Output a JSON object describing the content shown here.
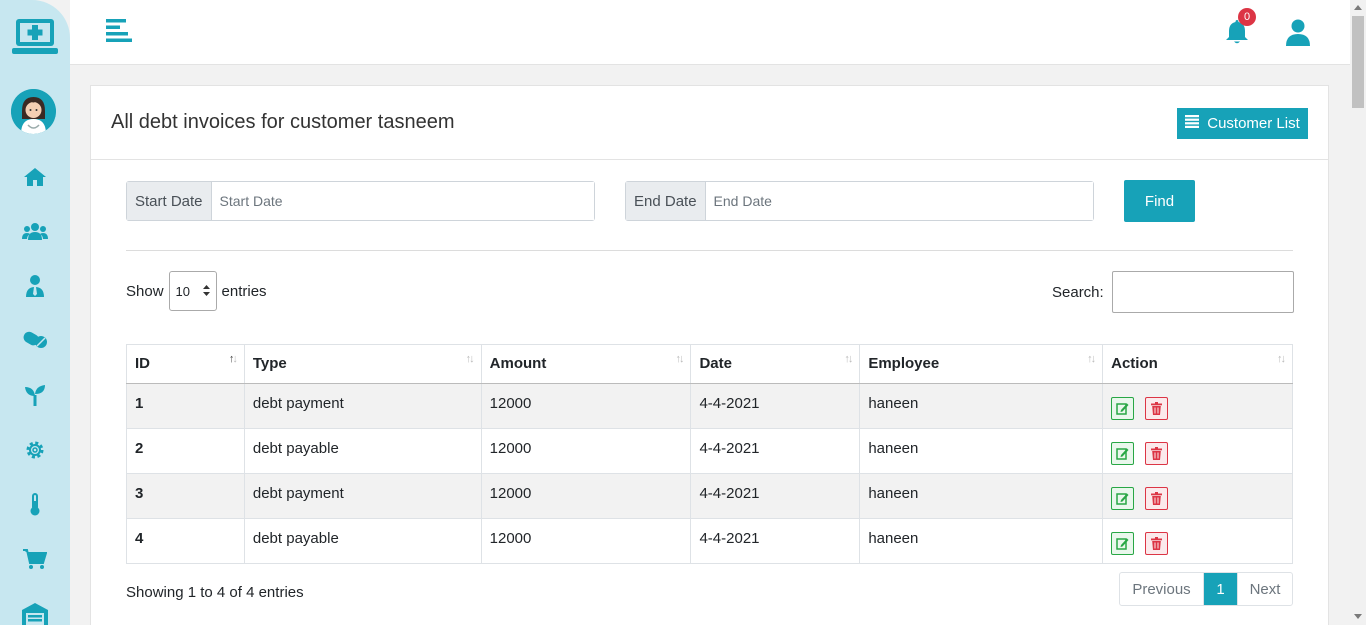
{
  "header": {
    "notification_count": "0"
  },
  "page": {
    "title": "All debt invoices for customer tasneem",
    "customer_list_label": "Customer List"
  },
  "filters": {
    "start_label": "Start Date",
    "start_placeholder": "Start Date",
    "end_label": "End Date",
    "end_placeholder": "End Date",
    "find_label": "Find"
  },
  "table_controls": {
    "show_label": "Show",
    "length_value": "10",
    "entries_label": "entries",
    "search_label": "Search:"
  },
  "table": {
    "columns": [
      "ID",
      "Type",
      "Amount",
      "Date",
      "Employee",
      "Action"
    ],
    "rows": [
      {
        "id": "1",
        "type": "debt payment",
        "amount": "12000",
        "date": "4-4-2021",
        "employee": "haneen"
      },
      {
        "id": "2",
        "type": "debt payable",
        "amount": "12000",
        "date": "4-4-2021",
        "employee": "haneen"
      },
      {
        "id": "3",
        "type": "debt payment",
        "amount": "12000",
        "date": "4-4-2021",
        "employee": "haneen"
      },
      {
        "id": "4",
        "type": "debt payable",
        "amount": "12000",
        "date": "4-4-2021",
        "employee": "haneen"
      }
    ]
  },
  "footer": {
    "info": "Showing 1 to 4 of 4 entries",
    "previous": "Previous",
    "page": "1",
    "next": "Next"
  },
  "sidebar": {
    "icons": [
      "home-icon",
      "users-icon",
      "user-tie-icon",
      "pills-icon",
      "seedling-icon",
      "gear-icon",
      "thermometer-icon",
      "cart-icon",
      "warehouse-icon"
    ]
  },
  "colors": {
    "accent": "#17a2b8",
    "sidebar_bg": "#c7e7f0",
    "danger": "#dc3545",
    "success": "#28a745"
  }
}
